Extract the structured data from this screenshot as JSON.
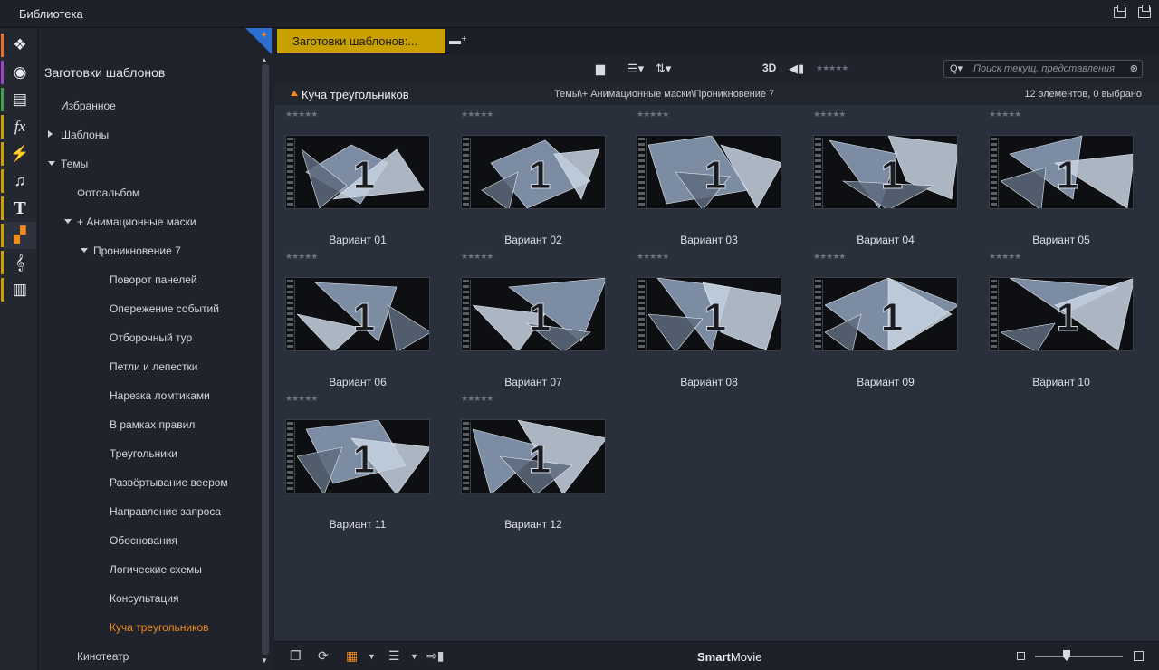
{
  "window": {
    "title": "Библиотека"
  },
  "iconbar": {
    "items": [
      {
        "name": "projects-icon",
        "glyph": "❖",
        "color": "#e8702a"
      },
      {
        "name": "video-reel-icon",
        "glyph": "◉",
        "color": "#9b44c8"
      },
      {
        "name": "photos-icon",
        "glyph": "▤",
        "color": "#3ea34a"
      },
      {
        "name": "effects-icon",
        "glyph": "fx",
        "color": "#d0a000"
      },
      {
        "name": "transitions-icon",
        "glyph": "⚡",
        "color": "#d0a000"
      },
      {
        "name": "music-icon",
        "glyph": "♫",
        "color": "#d0a000"
      },
      {
        "name": "titles-icon",
        "glyph": "T",
        "color": "#d0a000"
      },
      {
        "name": "templates-icon",
        "glyph": "▞",
        "color": "#d0a000"
      },
      {
        "name": "scorefitter-icon",
        "glyph": "𝄞",
        "color": "#d0a000"
      },
      {
        "name": "piano-icon",
        "glyph": "▥",
        "color": "#d0a000"
      }
    ]
  },
  "nav": {
    "heading": "Заготовки шаблонов",
    "items": [
      {
        "label": "Избранное",
        "level": 0,
        "arrow": ""
      },
      {
        "label": "Шаблоны",
        "level": 0,
        "arrow": "r"
      },
      {
        "label": "Темы",
        "level": 0,
        "arrow": "d"
      },
      {
        "label": "Фотоальбом",
        "level": 1,
        "arrow": ""
      },
      {
        "label": "+ Анимационные маски",
        "level": 1,
        "arrow": "d"
      },
      {
        "label": "Проникновение 7",
        "level": 2,
        "arrow": "d"
      },
      {
        "label": "Поворот панелей",
        "level": 3,
        "arrow": ""
      },
      {
        "label": "Опережение событий",
        "level": 3,
        "arrow": ""
      },
      {
        "label": "Отборочный тур",
        "level": 3,
        "arrow": ""
      },
      {
        "label": "Петли и лепестки",
        "level": 3,
        "arrow": ""
      },
      {
        "label": "Нарезка ломтиками",
        "level": 3,
        "arrow": ""
      },
      {
        "label": "В рамках правил",
        "level": 3,
        "arrow": ""
      },
      {
        "label": "Треугольники",
        "level": 3,
        "arrow": ""
      },
      {
        "label": "Развёртывание веером",
        "level": 3,
        "arrow": ""
      },
      {
        "label": "Направление запроса",
        "level": 3,
        "arrow": ""
      },
      {
        "label": "Обоснования",
        "level": 3,
        "arrow": ""
      },
      {
        "label": "Логические схемы",
        "level": 3,
        "arrow": ""
      },
      {
        "label": "Консультация",
        "level": 3,
        "arrow": ""
      },
      {
        "label": "Куча треугольников",
        "level": 3,
        "arrow": "",
        "selected": true
      },
      {
        "label": "Кинотеатр",
        "level": 1,
        "arrow": ""
      }
    ]
  },
  "tabs": {
    "active": "Заготовки шаблонов:...",
    "add_icon": "add-tab-icon"
  },
  "toolbar": {
    "label_3d": "3D",
    "stars": "★★★★★",
    "search_placeholder": "Поиск текущ. представления"
  },
  "info": {
    "caption": "Куча треугольников",
    "path": "Темы\\+ Анимационные маски\\Проникновение 7",
    "count": "12 элементов, 0 выбрано"
  },
  "items": [
    {
      "label": "Вариант 01",
      "stars": "★★★★★"
    },
    {
      "label": "Вариант 02",
      "stars": "★★★★★"
    },
    {
      "label": "Вариант 03",
      "stars": "★★★★★"
    },
    {
      "label": "Вариант 04",
      "stars": "★★★★★"
    },
    {
      "label": "Вариант 05",
      "stars": "★★★★★"
    },
    {
      "label": "Вариант 06",
      "stars": "★★★★★"
    },
    {
      "label": "Вариант 07",
      "stars": "★★★★★"
    },
    {
      "label": "Вариант 08",
      "stars": "★★★★★"
    },
    {
      "label": "Вариант 09",
      "stars": "★★★★★"
    },
    {
      "label": "Вариант 10",
      "stars": "★★★★★"
    },
    {
      "label": "Вариант 11",
      "stars": "★★★★★"
    },
    {
      "label": "Вариант 12",
      "stars": "★★★★★"
    }
  ],
  "thumb_digit": "1",
  "bottombar": {
    "brand_bold": "Smart",
    "brand_rest": "Movie"
  },
  "colors": {
    "accent": "#f08a1c",
    "tab": "#c8a000",
    "panel": "#2a2f3c"
  }
}
